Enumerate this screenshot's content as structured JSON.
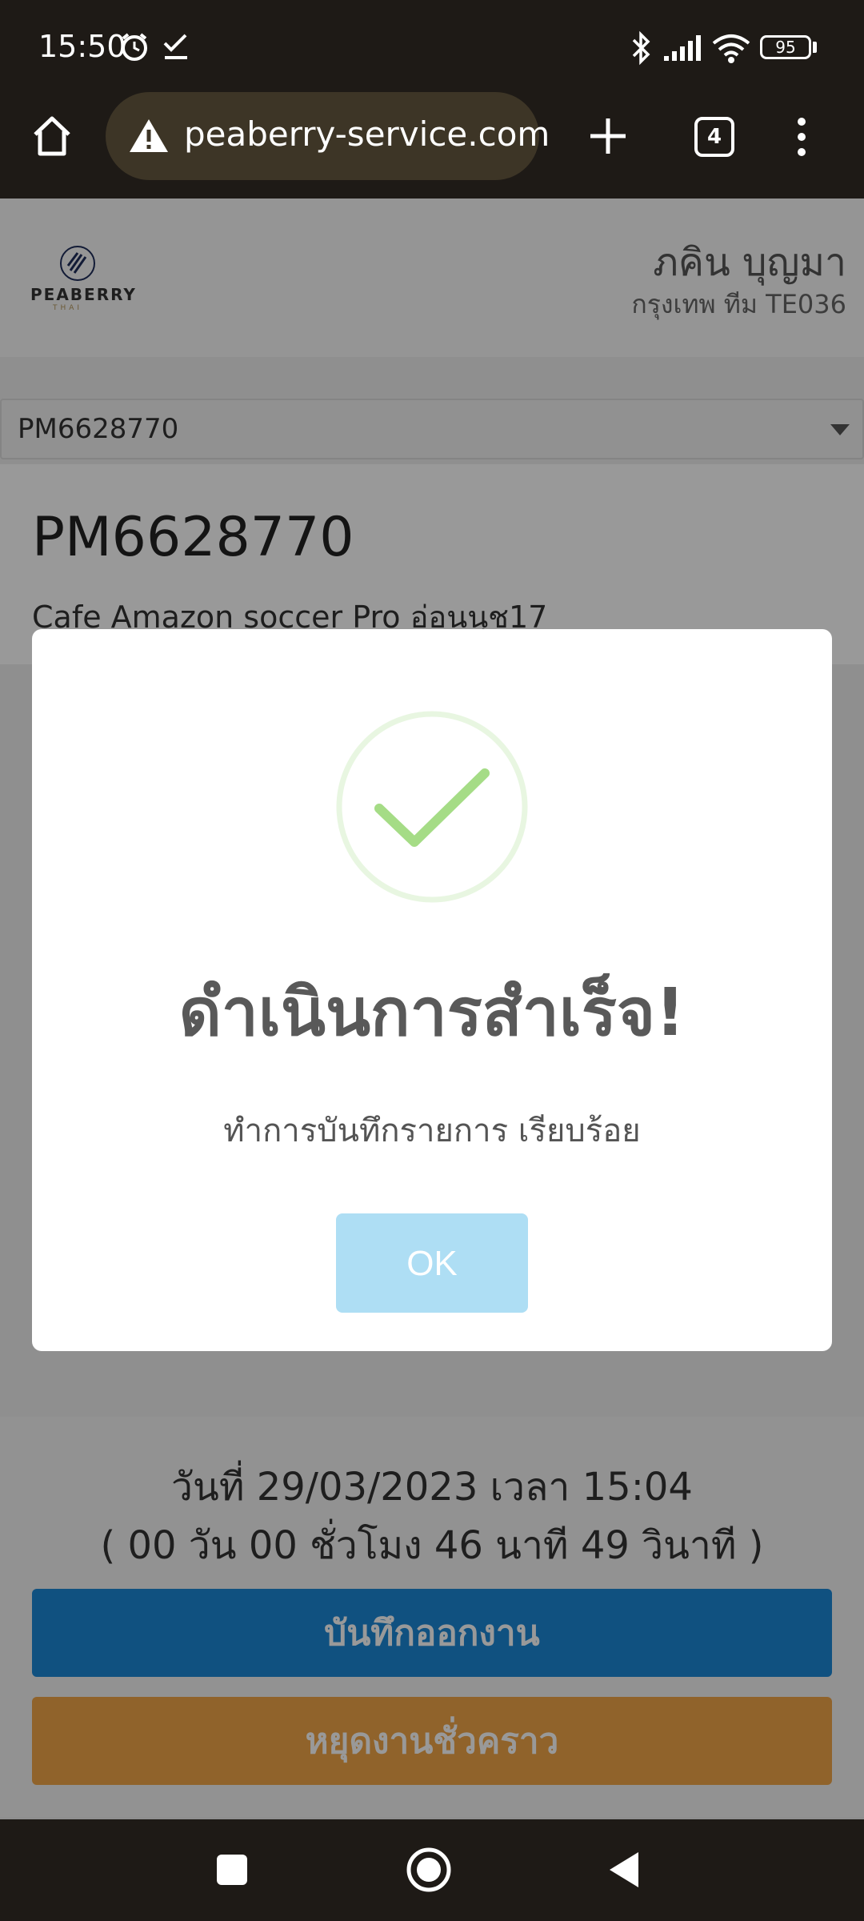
{
  "status_bar": {
    "time": "15:50",
    "battery": "95",
    "icons": [
      "alarm-icon",
      "check-icon",
      "bluetooth-icon",
      "signal-icon",
      "wifi-icon",
      "battery-icon"
    ]
  },
  "browser": {
    "url": "peaberry-service.com",
    "tab_count": "4",
    "icons": [
      "home-icon",
      "warning-icon",
      "add-tab-icon",
      "tabs-icon",
      "more-icon"
    ]
  },
  "header": {
    "logo_text": "PEABERRY",
    "logo_sub": "THAI",
    "user_name": "ภคิน บุญมา",
    "team": "กรุงเทพ ทีม TE036"
  },
  "job_select": {
    "selected": "PM6628770"
  },
  "job": {
    "id": "PM6628770",
    "place": "Cafe Amazon soccer Pro อ่อนนุช17"
  },
  "modal": {
    "title": "ดำเนินการสำเร็จ!",
    "text": "ทำการบันทึกรายการ เรียบร้อย",
    "ok_label": "OK",
    "icon": "success-check-icon",
    "accent": "#a5dc86"
  },
  "footer": {
    "date_line": "วันที่ 29/03/2023 เวลา 15:04",
    "duration_line": "( 00 วัน 00 ชั่วโมง 46 นาที 49 วินาที )",
    "checkout_label": "บันทึกออกงาน",
    "pause_label": "หยุดงานชั่วคราว",
    "checkout_color": "#1c87d6",
    "pause_color": "#f0a548"
  },
  "nav": {
    "icons": [
      "recents-icon",
      "home-circle-icon",
      "back-icon"
    ]
  }
}
